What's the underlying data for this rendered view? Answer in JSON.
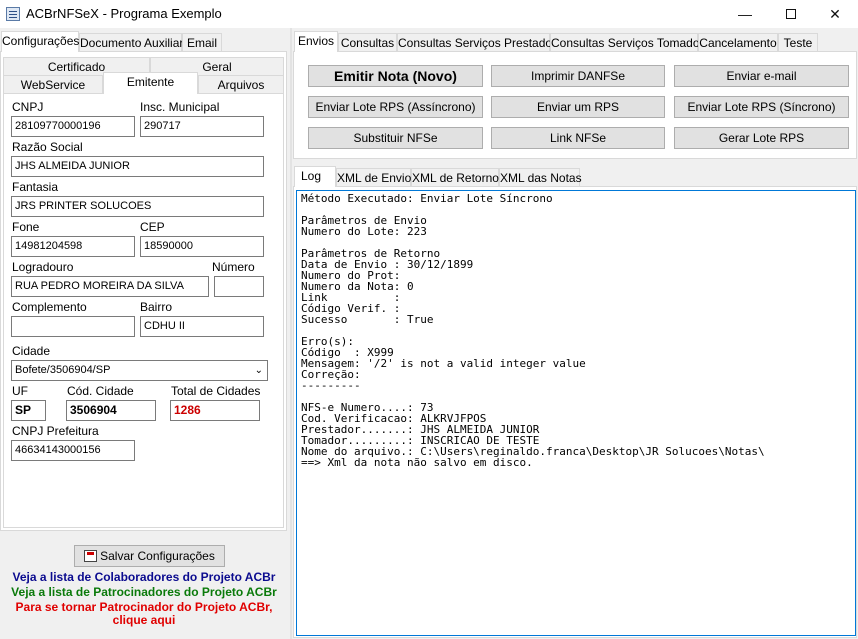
{
  "window": {
    "title": "ACBrNFSeX - Programa Exemplo"
  },
  "left_tabs": {
    "row1": [
      "Configurações",
      "Documento Auxiliar",
      "Email"
    ],
    "row2": [
      "Certificado",
      "Geral"
    ],
    "row3": [
      "WebService",
      "Emitente",
      "Arquivos"
    ]
  },
  "emitente": {
    "cnpj_label": "CNPJ",
    "cnpj": "28109770000196",
    "im_label": "Insc. Municipal",
    "im": "290717",
    "razao_label": "Razão Social",
    "razao": "JHS ALMEIDA JUNIOR",
    "fantasia_label": "Fantasia",
    "fantasia": "JRS PRINTER SOLUCOES",
    "fone_label": "Fone",
    "fone": "14981204598",
    "cep_label": "CEP",
    "cep": "18590000",
    "logradouro_label": "Logradouro",
    "logradouro": "RUA PEDRO MOREIRA DA SILVA",
    "numero_label": "Número",
    "numero": "",
    "complemento_label": "Complemento",
    "complemento": "",
    "bairro_label": "Bairro",
    "bairro": "CDHU II",
    "cidade_label": "Cidade",
    "cidade": "Bofete/3506904/SP",
    "uf_label": "UF",
    "uf": "SP",
    "cod_cidade_label": "Cód. Cidade",
    "cod_cidade": "3506904",
    "total_cidades_label": "Total de Cidades",
    "total_cidades": "1286",
    "cnpj_pref_label": "CNPJ Prefeitura",
    "cnpj_pref": "46634143000156"
  },
  "save_button": "Salvar Configurações",
  "links": {
    "colaboradores": "Veja a lista de Colaboradores do Projeto ACBr",
    "patrocinadores": "Veja a lista de Patrocinadores do Projeto ACBr",
    "tornar1": "Para se tornar Patrocinador do Projeto ACBr,",
    "tornar2": "clique aqui"
  },
  "right_tabs": [
    "Envios",
    "Consultas",
    "Consultas Serviços Prestados",
    "Consultas Serviços Tomados",
    "Cancelamento",
    "Teste"
  ],
  "actions": {
    "emitir": "Emitir Nota (Novo)",
    "imprimir": "Imprimir DANFSe",
    "email": "Enviar e-mail",
    "lote_assinc": "Enviar Lote RPS (Assíncrono)",
    "um_rps": "Enviar um RPS",
    "lote_sinc": "Enviar Lote RPS (Síncrono)",
    "substituir": "Substituir NFSe",
    "link": "Link NFSe",
    "gerar_lote": "Gerar Lote RPS"
  },
  "log_tabs": [
    "Log",
    "XML de Envio",
    "XML de Retorno",
    "XML das Notas"
  ],
  "log_text": "Método Executado: Enviar Lote Síncrono\n\nParâmetros de Envio\nNumero do Lote: 223\n\nParâmetros de Retorno\nData de Envio : 30/12/1899\nNumero do Prot:\nNumero da Nota: 0\nLink          :\nCódigo Verif. :\nSucesso       : True\n\nErro(s):\nCódigo  : X999\nMensagem: '/2' is not a valid integer value\nCorreção:\n---------\n\nNFS-e Numero....: 73\nCod. Verificacao: ALKRVJFPOS\nPrestador.......: JHS ALMEIDA JUNIOR\nTomador.........: INSCRICAO DE TESTE\nNome do arquivo.: C:\\Users\\reginaldo.franca\\Desktop\\JR Solucoes\\Notas\\\n==> Xml da nota não salvo em disco.",
  "colors": {
    "link_blue": "#0b0b8f",
    "link_green": "#0a7a0a",
    "link_red": "#e00000",
    "total_red": "#cc0000"
  }
}
